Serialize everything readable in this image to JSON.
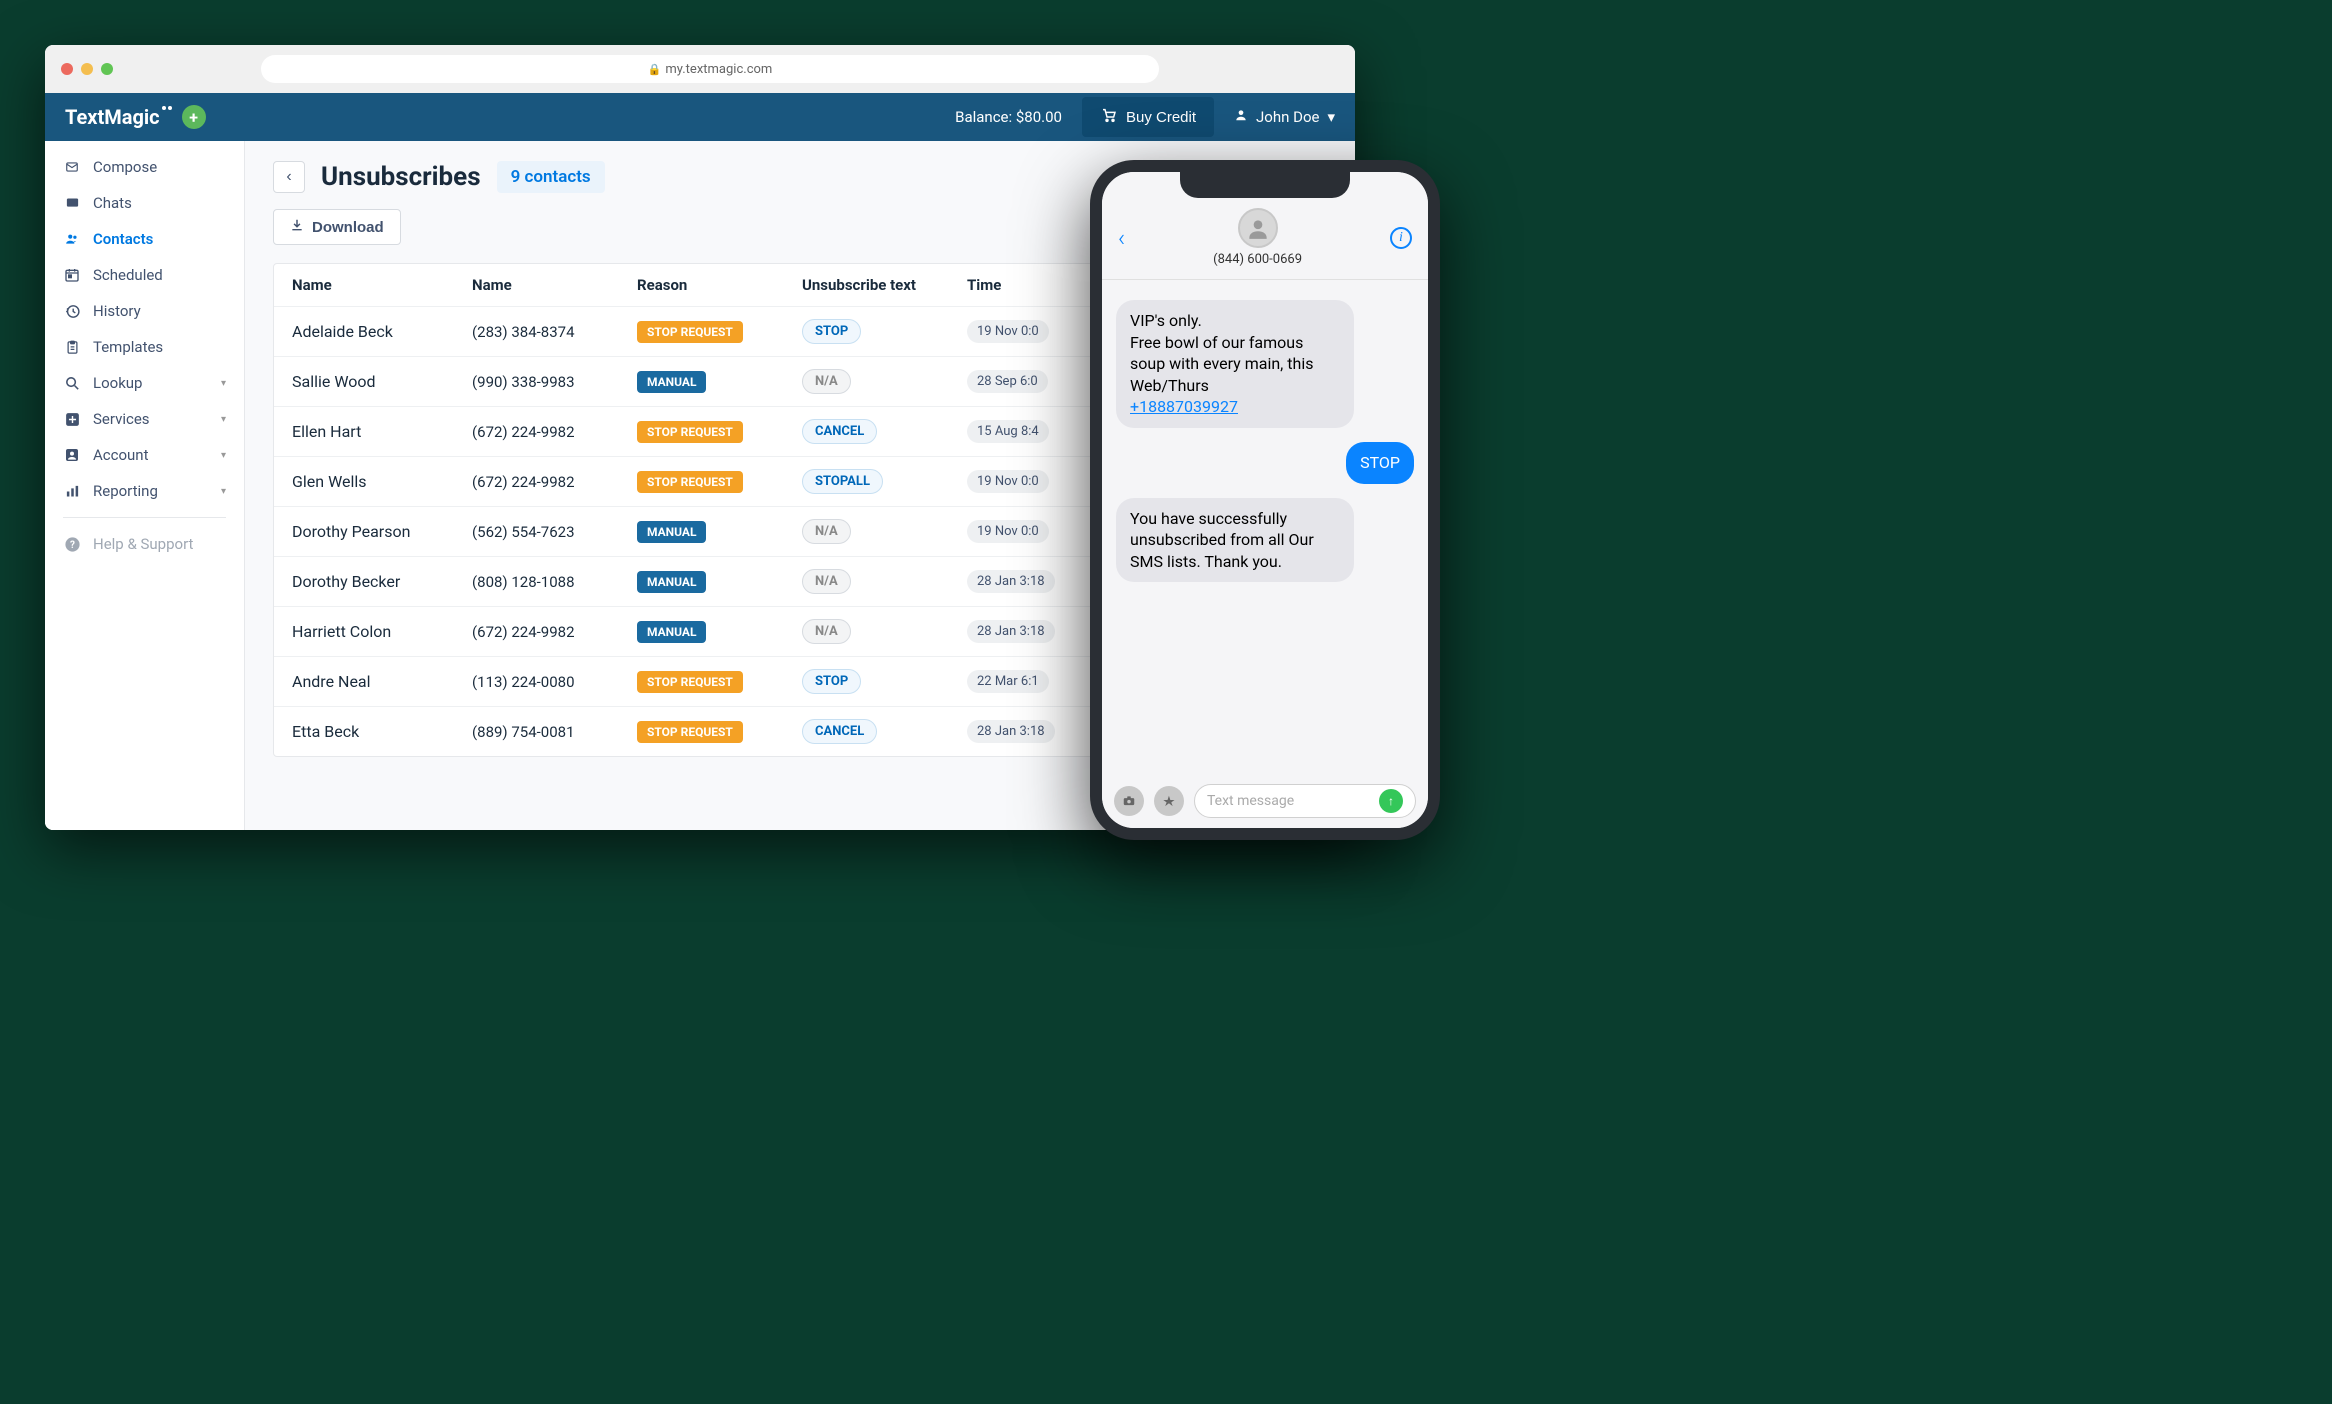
{
  "browser": {
    "url": "my.textmagic.com"
  },
  "brand": {
    "name": "TextMagic"
  },
  "nav": {
    "balance_label": "Balance: $80.00",
    "buy_credit_label": "Buy Credit",
    "user_name": "John Doe"
  },
  "sidebar": {
    "items": [
      {
        "label": "Compose",
        "icon": "compose"
      },
      {
        "label": "Chats",
        "icon": "chat"
      },
      {
        "label": "Contacts",
        "icon": "contacts",
        "active": true
      },
      {
        "label": "Scheduled",
        "icon": "calendar"
      },
      {
        "label": "History",
        "icon": "history"
      },
      {
        "label": "Templates",
        "icon": "template"
      },
      {
        "label": "Lookup",
        "icon": "search",
        "expandable": true
      },
      {
        "label": "Services",
        "icon": "services",
        "expandable": true
      },
      {
        "label": "Account",
        "icon": "account",
        "expandable": true
      },
      {
        "label": "Reporting",
        "icon": "reporting",
        "expandable": true
      }
    ],
    "help_label": "Help & Support"
  },
  "page": {
    "title": "Unsubscribes",
    "count_label": "9 contacts",
    "download_label": "Download"
  },
  "table": {
    "headers": {
      "name": "Name",
      "phone": "Name",
      "reason": "Reason",
      "text": "Unsubscribe text",
      "time": "Time"
    },
    "rows": [
      {
        "name": "Adelaide Beck",
        "phone": "(283) 384-8374",
        "reason": "STOP REQUEST",
        "reason_color": "orange",
        "text": "STOP",
        "text_style": "blue",
        "time": "19 Nov 0:0"
      },
      {
        "name": "Sallie Wood",
        "phone": "(990) 338-9983",
        "reason": "MANUAL",
        "reason_color": "blue",
        "text": "N/A",
        "text_style": "gray",
        "time": "28 Sep 6:0"
      },
      {
        "name": "Ellen Hart",
        "phone": "(672) 224-9982",
        "reason": "STOP REQUEST",
        "reason_color": "orange",
        "text": "CANCEL",
        "text_style": "blue",
        "time": "15 Aug 8:4"
      },
      {
        "name": "Glen Wells",
        "phone": "(672) 224-9982",
        "reason": "STOP REQUEST",
        "reason_color": "orange",
        "text": "STOPALL",
        "text_style": "blue",
        "time": "19 Nov 0:0"
      },
      {
        "name": "Dorothy Pearson",
        "phone": "(562) 554-7623",
        "reason": "MANUAL",
        "reason_color": "blue",
        "text": "N/A",
        "text_style": "gray",
        "time": "19 Nov 0:0"
      },
      {
        "name": "Dorothy Becker",
        "phone": "(808) 128-1088",
        "reason": "MANUAL",
        "reason_color": "blue",
        "text": "N/A",
        "text_style": "gray",
        "time": "28 Jan 3:18"
      },
      {
        "name": "Harriett Colon",
        "phone": "(672) 224-9982",
        "reason": "MANUAL",
        "reason_color": "blue",
        "text": "N/A",
        "text_style": "gray",
        "time": "28 Jan 3:18"
      },
      {
        "name": "Andre Neal",
        "phone": "(113) 224-0080",
        "reason": "STOP REQUEST",
        "reason_color": "orange",
        "text": "STOP",
        "text_style": "blue",
        "time": "22 Mar 6:1"
      },
      {
        "name": "Etta Beck",
        "phone": "(889) 754-0081",
        "reason": "STOP REQUEST",
        "reason_color": "orange",
        "text": "CANCEL",
        "text_style": "blue",
        "time": "28 Jan 3:18"
      }
    ]
  },
  "phone": {
    "number": "(844) 600-0669",
    "msg1": "VIP's only.\nFree bowl of our famous soup with every main, this Web/Thurs",
    "msg1_link": "+18887039927",
    "msg2": "STOP",
    "msg3": "You have successfully unsubscribed from all Our SMS lists. Thank you.",
    "input_placeholder": "Text message"
  }
}
